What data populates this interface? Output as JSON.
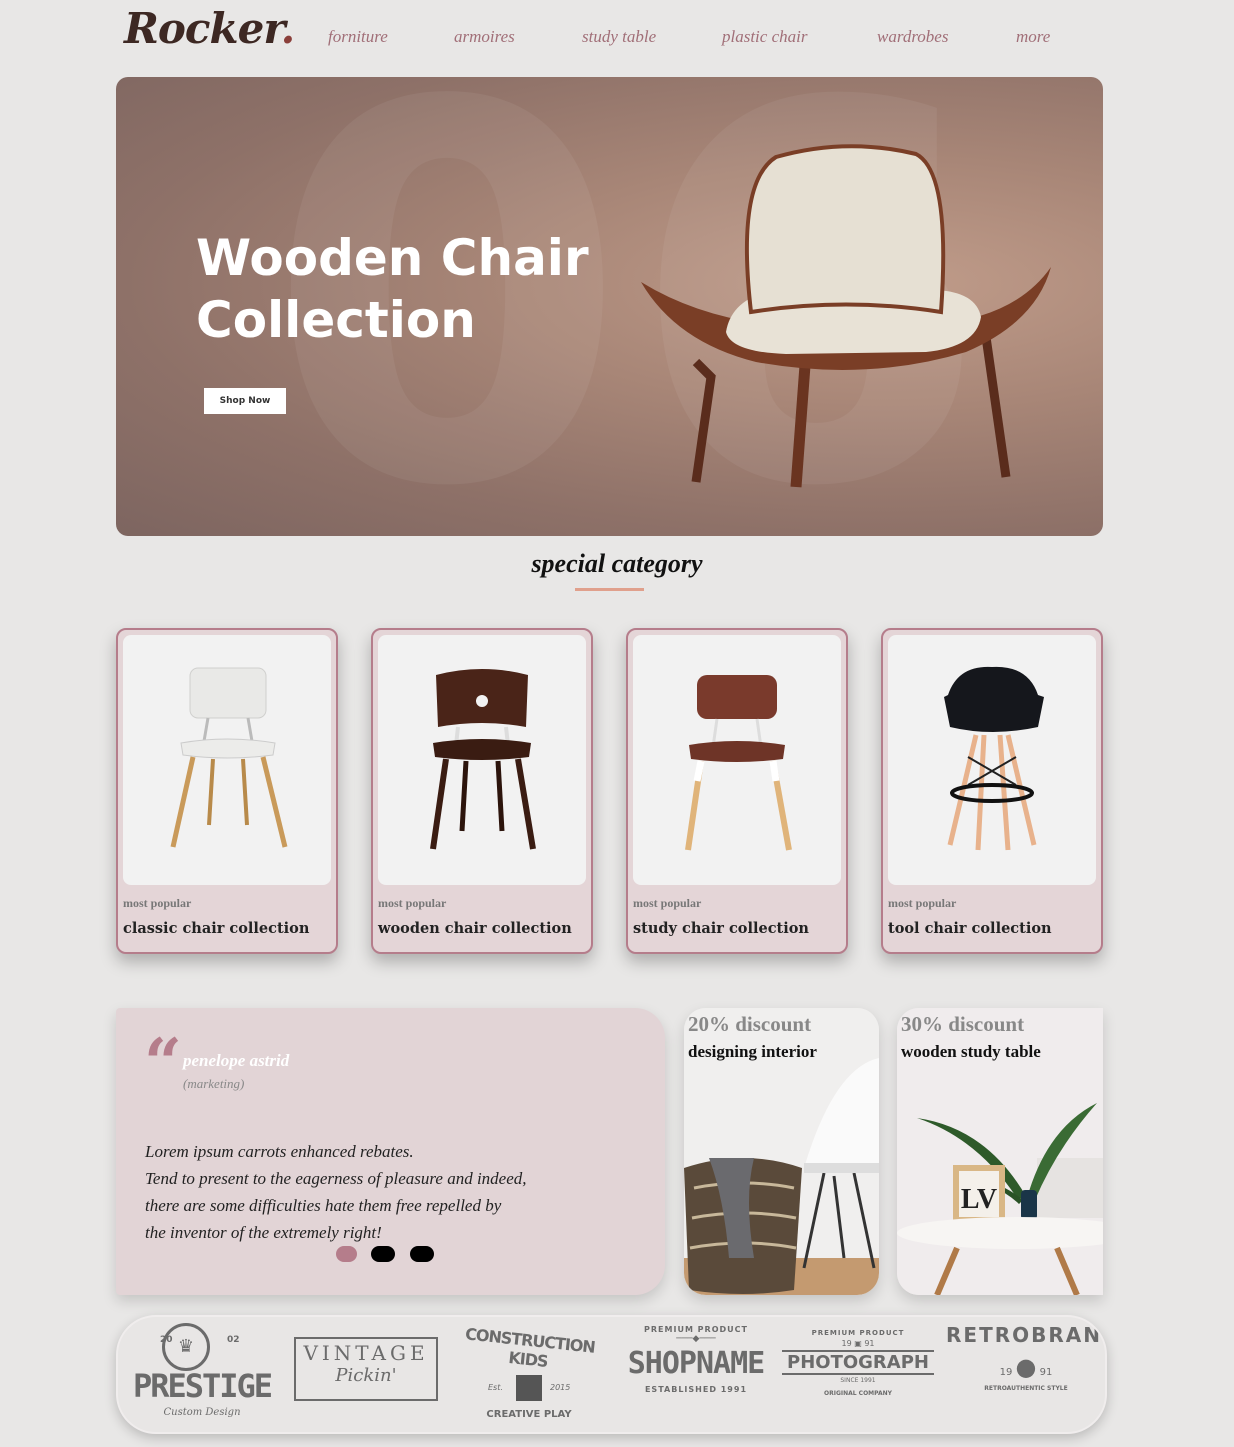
{
  "logo": {
    "text": "Rocker",
    "dot": "."
  },
  "nav": [
    "forniture",
    "armoires",
    "study table",
    "plastic chair",
    "wardrobes",
    "more"
  ],
  "hero": {
    "title_line1": "Wooden Chair",
    "title_line2": "Collection",
    "button": "Shop Now",
    "bg_number": "06"
  },
  "special": {
    "title": "special category"
  },
  "cards": [
    {
      "tag": "most popular",
      "title": "classic chair collection"
    },
    {
      "tag": "most popular",
      "title": "wooden chair collection"
    },
    {
      "tag": "most popular",
      "title": "study chair collection"
    },
    {
      "tag": "most popular",
      "title": "tool chair collection"
    }
  ],
  "testimonial": {
    "name": "penelope astrid",
    "role": "(marketing)",
    "lines": [
      "Lorem ipsum carrots enhanced rebates.",
      "Tend to present to the eagerness of pleasure and indeed,",
      "there are some difficulties hate them free repelled by",
      "the inventor of the extremely right!"
    ]
  },
  "promos": [
    {
      "discount": "20% discount",
      "subtitle": "designing interior"
    },
    {
      "discount": "30% discount",
      "subtitle": "wooden study table"
    }
  ],
  "brands": {
    "prestige": {
      "top_left": "20",
      "top_right": "02",
      "name": "PRESTIGE",
      "sub": "Custom Design"
    },
    "vintage": {
      "name": "VINTAGE",
      "sub": "Pickin'"
    },
    "construction": {
      "arc": "CONSTRUCTION KIDS",
      "left": "Est.",
      "right": "2015",
      "sub": "CREATIVE PLAY"
    },
    "shopname": {
      "arc": "PREMIUM PRODUCT",
      "name": "SHOPNAME",
      "sub": "ESTABLISHED 1991"
    },
    "photograph": {
      "arc": "PREMIUM PRODUCT",
      "left": "19",
      "right": "91",
      "name": "PHOTOGRAPH",
      "sub": "SINCE 1991",
      "bottom": "ORIGINAL COMPANY"
    },
    "retrobrand": {
      "arc": "RETROBRAND",
      "left": "19",
      "right": "91",
      "sub": "RETROAUTHENTIC STYLE"
    }
  },
  "colors": {
    "accent": "#b57d8b",
    "nav": "#a16f78",
    "underline": "#e0a08c",
    "hero_bg": "#a88677"
  }
}
